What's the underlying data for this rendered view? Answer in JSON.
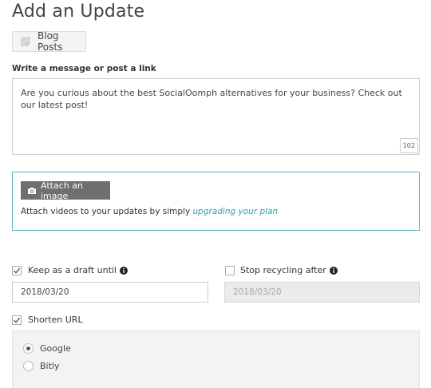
{
  "page": {
    "title": "Add an Update"
  },
  "category": {
    "label": "Blog Posts",
    "icon": "note-icon"
  },
  "message": {
    "label": "Write a message or post a link",
    "text": "Are you curious about the best SocialOomph alternatives for your business? Check out our latest post!",
    "char_count": "102"
  },
  "attach": {
    "button_label": "Attach an image",
    "button_icon": "camera-icon",
    "text": "Attach videos to your updates by simply ",
    "link_text": "upgrading your plan",
    "border_color": "#5ab4bf",
    "link_color": "#2a9eb0"
  },
  "draft": {
    "checked": true,
    "label": "Keep as a draft until",
    "date": "2018/03/20"
  },
  "recycling": {
    "checked": false,
    "label": "Stop recycling after",
    "date": "2018/03/20"
  },
  "shorten": {
    "checked": true,
    "label": "Shorten URL",
    "options": [
      {
        "label": "Google",
        "selected": true
      },
      {
        "label": "Bitly",
        "selected": false
      }
    ]
  }
}
